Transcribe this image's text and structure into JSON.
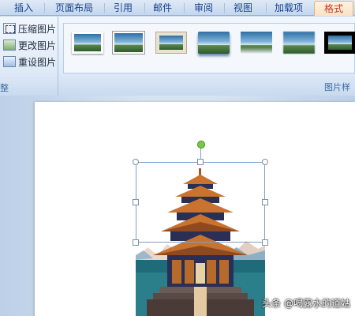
{
  "tabs": [
    {
      "label": "插入"
    },
    {
      "label": "页面布局"
    },
    {
      "label": "引用"
    },
    {
      "label": "邮件"
    },
    {
      "label": "审阅"
    },
    {
      "label": "视图"
    },
    {
      "label": "加载项"
    },
    {
      "label": "格式"
    }
  ],
  "adjust_group": {
    "items": [
      {
        "label": "压缩图片",
        "icon": "compress-picture-icon"
      },
      {
        "label": "更改图片",
        "icon": "change-picture-icon"
      },
      {
        "label": "重设图片",
        "icon": "reset-picture-icon"
      }
    ],
    "title": "整"
  },
  "picture_styles": {
    "title": "图片样",
    "thumbnails": [
      {
        "name": "simple-frame-white"
      },
      {
        "name": "thin-frame"
      },
      {
        "name": "beige-frame"
      },
      {
        "name": "soft-shadow"
      },
      {
        "name": "reflected"
      },
      {
        "name": "soft-edge"
      },
      {
        "name": "thick-black-frame"
      }
    ]
  },
  "watermark": "头条 @喝露水的道姑",
  "colors": {
    "ribbon_blue": "#dfeaf7",
    "tab_text": "#15428b",
    "active_tab_text": "#c0392b",
    "selection_border": "#7f9fc8",
    "rotate_handle": "#7ac943"
  }
}
